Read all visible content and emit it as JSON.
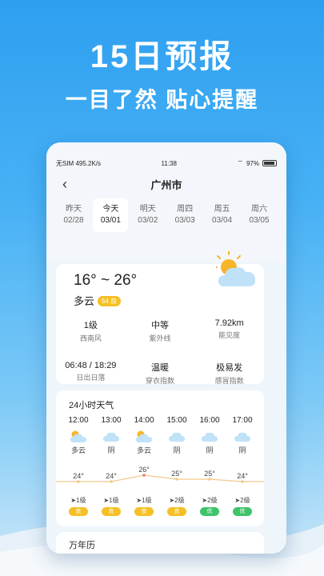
{
  "promo": {
    "title": "15日预报",
    "subtitle": "一目了然 贴心提醒"
  },
  "statusbar": {
    "left": "无SIM 495.2K/s",
    "time": "11:38",
    "battery": "97%"
  },
  "nav": {
    "back": "‹",
    "city": "广州市"
  },
  "days": [
    {
      "name": "昨天",
      "date": "02/28"
    },
    {
      "name": "今天",
      "date": "03/01"
    },
    {
      "name": "明天",
      "date": "03/02"
    },
    {
      "name": "周四",
      "date": "03/03"
    },
    {
      "name": "周五",
      "date": "03/04"
    },
    {
      "name": "周六",
      "date": "03/05"
    }
  ],
  "today": {
    "temp_range": "16° ~ 26°",
    "condition": "多云",
    "aqi": "54 良",
    "details": [
      {
        "value": "1级",
        "label": "西南风"
      },
      {
        "value": "中等",
        "label": "紫外线"
      },
      {
        "value": "7.92km",
        "label": "能见度"
      },
      {
        "value": "06:48 / 18:29",
        "label": "日出日落"
      },
      {
        "value": "温暖",
        "label": "穿衣指数"
      },
      {
        "value": "极易发",
        "label": "感冒指数"
      }
    ]
  },
  "hourly": {
    "title": "24小时天气",
    "hours": [
      {
        "time": "12:00",
        "icon": "partly-cloudy-icon",
        "cond": "多云",
        "temp": "24°",
        "wind": "1级",
        "aqi": "良"
      },
      {
        "time": "13:00",
        "icon": "cloudy-icon",
        "cond": "阴",
        "temp": "24°",
        "wind": "1级",
        "aqi": "良"
      },
      {
        "time": "14:00",
        "icon": "partly-cloudy-icon",
        "cond": "多云",
        "temp": "26°",
        "wind": "1级",
        "aqi": "良"
      },
      {
        "time": "15:00",
        "icon": "cloudy-icon",
        "cond": "阴",
        "temp": "25°",
        "wind": "2级",
        "aqi": "良"
      },
      {
        "time": "16:00",
        "icon": "cloudy-icon",
        "cond": "阴",
        "temp": "25°",
        "wind": "2级",
        "aqi": "优"
      },
      {
        "time": "17:00",
        "icon": "cloudy-icon",
        "cond": "阴",
        "temp": "24°",
        "wind": "2级",
        "aqi": "优"
      }
    ]
  },
  "next_card": {
    "title": "万年历"
  },
  "colors": {
    "aqi_good": "#f5c026",
    "aqi_excellent": "#3fc36a",
    "accent_blue": "#2e9ff0"
  }
}
